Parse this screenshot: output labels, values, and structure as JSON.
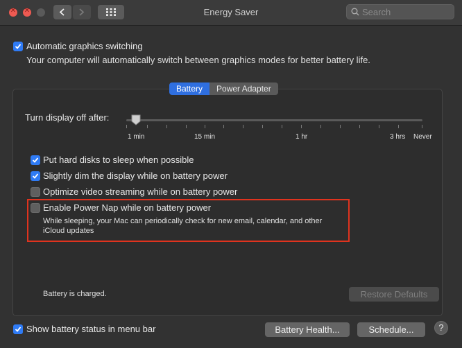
{
  "window": {
    "title": "Energy Saver"
  },
  "search": {
    "placeholder": "Search"
  },
  "graphics": {
    "checkbox_label": "Automatic graphics switching",
    "description": "Your computer will automatically switch between graphics modes for better battery life.",
    "checked": true
  },
  "tabs": [
    {
      "label": "Battery",
      "active": true
    },
    {
      "label": "Power Adapter",
      "active": false
    }
  ],
  "display_off": {
    "label": "Turn display off after:",
    "value": "1 min",
    "ticks": [
      "1 min",
      "15 min",
      "1 hr",
      "3 hrs",
      "Never"
    ]
  },
  "options": [
    {
      "label": "Put hard disks to sleep when possible",
      "checked": true
    },
    {
      "label": "Slightly dim the display while on battery power",
      "checked": true
    },
    {
      "label": "Optimize video streaming while on battery power",
      "checked": false
    },
    {
      "label": "Enable Power Nap while on battery power",
      "checked": false
    }
  ],
  "power_nap_description": {
    "line1": "While sleeping, your Mac can periodically check for new email, calendar, and other",
    "line2": "iCloud updates"
  },
  "status": {
    "battery": "Battery is charged."
  },
  "buttons": {
    "restore_defaults": "Restore Defaults",
    "battery_health": "Battery Health...",
    "schedule": "Schedule...",
    "help": "?"
  },
  "menu_bar_status": {
    "label": "Show battery status in menu bar",
    "checked": true
  },
  "colors": {
    "accent": "#2f7bf5",
    "highlight": "#e0331e"
  }
}
